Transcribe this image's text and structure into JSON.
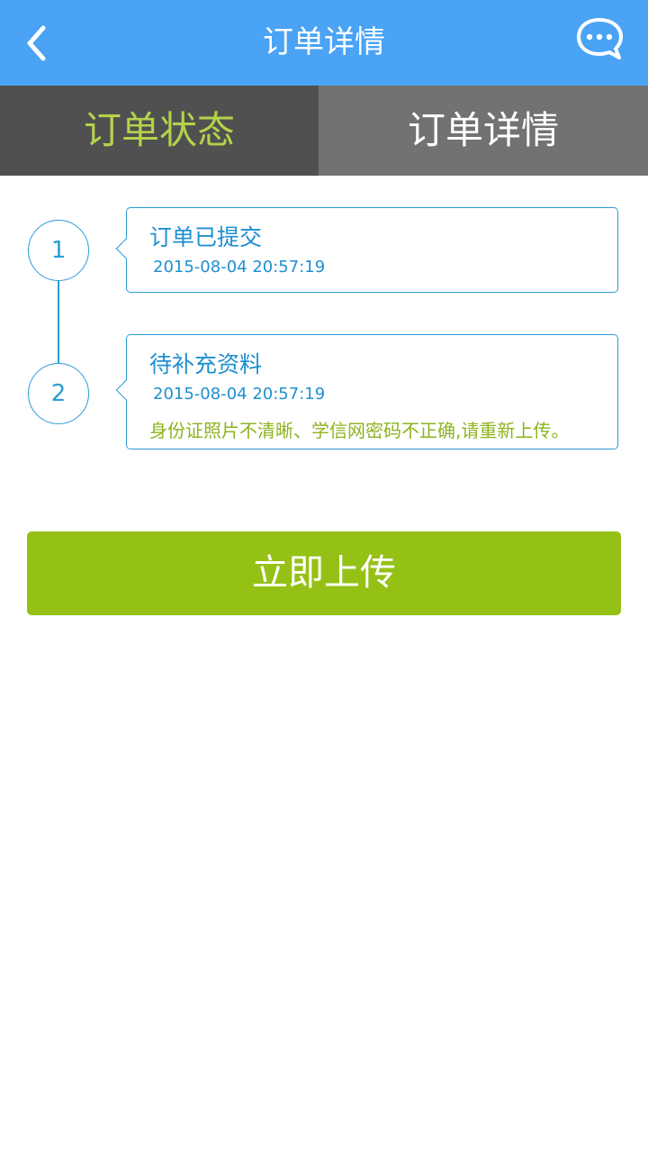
{
  "header": {
    "title": "订单详情",
    "back_icon": "chevron-left-icon",
    "chat_icon": "chat-bubble-dots-icon",
    "bg_color": "#4aa3f5"
  },
  "tabs": [
    {
      "label": "订单状态",
      "active": true,
      "color": "#b4d34a"
    },
    {
      "label": "订单详情",
      "active": false,
      "color": "#ffffff"
    }
  ],
  "timeline": [
    {
      "step": "1",
      "title": "订单已提交",
      "time": "2015-08-04  20:57:19"
    },
    {
      "step": "2",
      "title": "待补充资料",
      "time": "2015-08-04  20:57:19",
      "note": "身份证照片不清晰、学信网密码不正确,请重新上传。"
    }
  ],
  "action": {
    "upload_label": "立即上传",
    "color": "#95c116"
  },
  "colors": {
    "accent": "#2b9bd6",
    "note": "#8cb41e"
  }
}
